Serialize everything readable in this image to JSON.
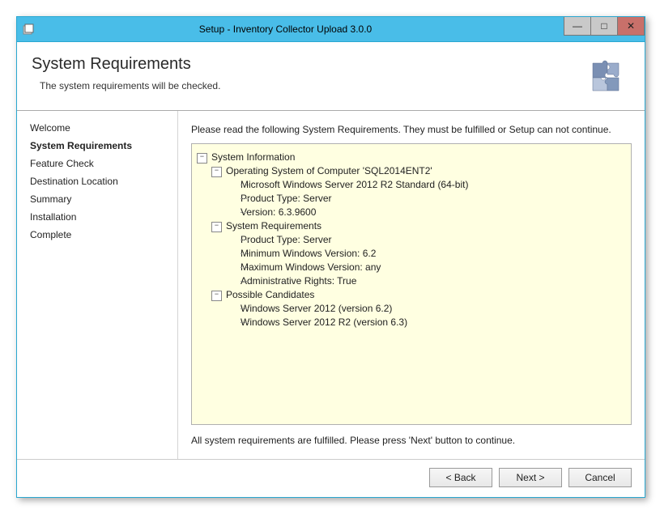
{
  "title": "Setup - Inventory Collector Upload 3.0.0",
  "header": {
    "title": "System Requirements",
    "subtitle": "The system requirements will be checked."
  },
  "sidebar": {
    "steps": [
      "Welcome",
      "System Requirements",
      "Feature Check",
      "Destination Location",
      "Summary",
      "Installation",
      "Complete"
    ],
    "current_index": 1
  },
  "main": {
    "instruction": "Please read the following System Requirements. They must be fulfilled or Setup can not continue.",
    "status": "All system requirements are fulfilled. Please press 'Next' button to continue."
  },
  "tree": {
    "root": {
      "label": "System Information",
      "children": [
        {
          "label": "Operating System of Computer 'SQL2014ENT2'",
          "children": [
            {
              "label": "Microsoft Windows Server 2012 R2 Standard (64-bit)"
            },
            {
              "label": "Product Type: Server"
            },
            {
              "label": "Version: 6.3.9600"
            }
          ]
        },
        {
          "label": "System Requirements",
          "children": [
            {
              "label": "Product Type: Server"
            },
            {
              "label": "Minimum Windows Version: 6.2"
            },
            {
              "label": "Maximum Windows Version: any"
            },
            {
              "label": "Administrative Rights: True"
            }
          ]
        },
        {
          "label": "Possible Candidates",
          "children": [
            {
              "label": "Windows Server 2012 (version 6.2)"
            },
            {
              "label": "Windows Server 2012 R2 (version 6.3)"
            }
          ]
        }
      ]
    }
  },
  "buttons": {
    "back": "<  Back",
    "next": "Next  >",
    "cancel": "Cancel"
  },
  "window_controls": {
    "minimize": "—",
    "maximize": "□",
    "close": "✕"
  }
}
